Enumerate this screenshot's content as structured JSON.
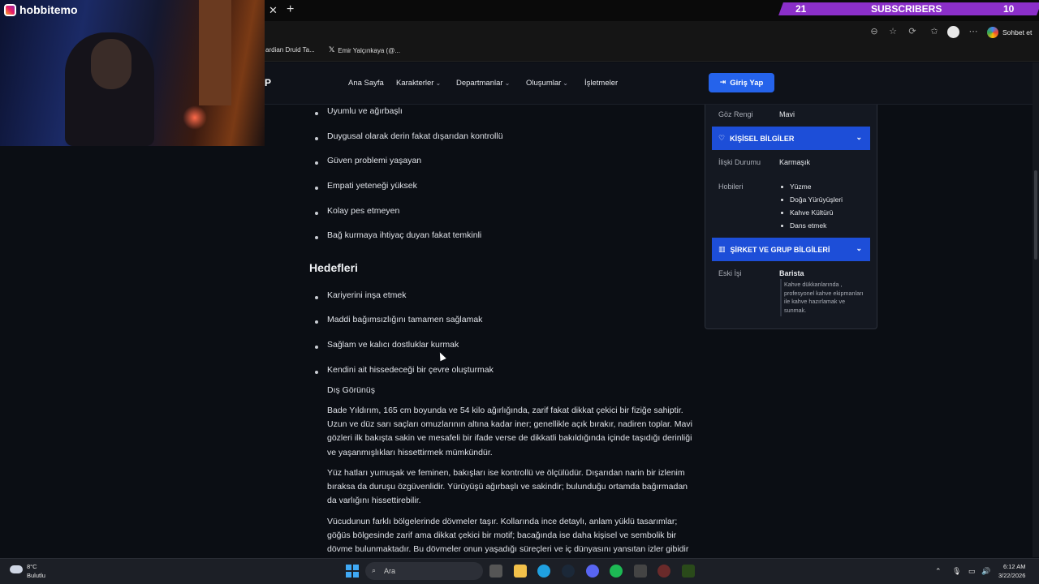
{
  "stream": {
    "channel_name": "hobbitemo",
    "sub_left": "21",
    "sub_label": "SUBSCRIBERS",
    "sub_right": "10"
  },
  "browser": {
    "copilot_label": "Sohbet et",
    "bookmarks": [
      "ardian Druid Ta...",
      "Emir Yalçınkaya (@..."
    ],
    "new_tab_icon": "plus-icon",
    "close_tab_icon": "close-icon"
  },
  "site": {
    "logo_partial": "P",
    "nav": [
      {
        "label": "Ana Sayfa",
        "dropdown": false
      },
      {
        "label": "Karakterler",
        "dropdown": true
      },
      {
        "label": "Departmanlar",
        "dropdown": true
      },
      {
        "label": "Oluşumlar",
        "dropdown": true
      },
      {
        "label": "İşletmeler",
        "dropdown": false
      }
    ],
    "login_label": "Giriş Yap"
  },
  "content": {
    "traits": [
      "Uyumlu ve ağırbaşlı",
      "Duygusal olarak derin fakat dışarıdan kontrollü",
      "Güven problemi yaşayan",
      "Empati yeteneği yüksek",
      "Kolay pes etmeyen",
      "Bağ kurmaya ihtiyaç duyan fakat temkinli"
    ],
    "goals_heading": "Hedefleri",
    "goals": [
      "Kariyerini inşa etmek",
      "Maddi bağımsızlığını tamamen sağlamak",
      "Sağlam ve kalıcı dostluklar kurmak",
      "Kendini ait hissedeceği bir çevre oluşturmak"
    ],
    "appearance_heading": "Dış Görünüş",
    "paragraphs": [
      "Bade Yıldırım, 165 cm boyunda ve 54 kilo ağırlığında, zarif fakat dikkat çekici bir fiziğe sahiptir. Uzun ve düz sarı saçları omuzlarının altına kadar iner; genellikle açık bırakır, nadiren toplar. Mavi gözleri ilk bakışta sakin ve mesafeli bir ifade verse de dikkatli bakıldığında içinde taşıdığı derinliği ve yaşanmışlıkları hissettirmek mümkündür.",
      "Yüz hatları yumuşak ve feminen, bakışları ise kontrollü ve ölçülüdür. Dışarıdan narin bir izlenim bıraksa da duruşu özgüvenlidir. Yürüyüşü ağırbaşlı ve sakindir; bulunduğu ortamda bağırmadan da varlığını hissettirebilir.",
      "Vücudunun farklı bölgelerinde dövmeler taşır. Kollarında ince detaylı, anlam yüklü tasarımlar; göğüs bölgesinde zarif ama dikkat çekici bir motif; bacağında ise daha kişisel ve sembolik bir dövme bulunmaktadır. Bu dövmeler onun yaşadığı süreçleri ve iç dünyasını yansıtan izler gibidir"
    ]
  },
  "sidebar": {
    "eye_label": "Göz Rengi",
    "eye_value": "Mavi",
    "personal_heading": "KİŞİSEL BİLGİLER",
    "relationship_label": "İlişki Durumu",
    "relationship_value": "Karmaşık",
    "hobbies_label": "Hobileri",
    "hobbies": [
      "Yüzme",
      "Doğa Yürüyüşleri",
      "Kahve Kültürü",
      "Dans etmek"
    ],
    "company_heading": "ŞİRKET VE GRUP BİLGİLERİ",
    "old_job_label": "Eski İşi",
    "old_job_value": "Barista",
    "old_job_desc": "Kahve dükkanlarında , profesyonel kahve ekipmanları ile kahve hazırlamak ve sunmak."
  },
  "taskbar": {
    "weather_temp": "8°C",
    "weather_desc": "Bulutlu",
    "search_placeholder": "Ara",
    "time": "6:12 AM",
    "date": "3/22/2026"
  }
}
